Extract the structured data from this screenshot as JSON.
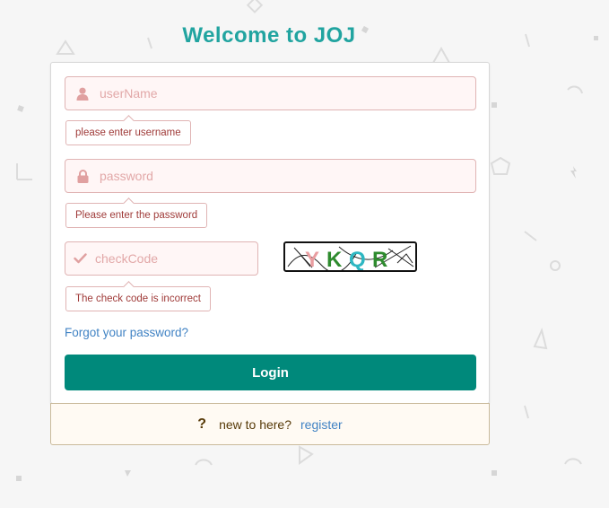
{
  "header": {
    "title": "Welcome to JOJ"
  },
  "form": {
    "username": {
      "placeholder": "userName",
      "value": "",
      "error": "please enter username",
      "icon": "user-icon"
    },
    "password": {
      "placeholder": "password",
      "value": "",
      "error": "Please enter the password",
      "icon": "lock-icon"
    },
    "checkcode": {
      "placeholder": "checkCode",
      "value": "",
      "error": "The check code is incorrect",
      "icon": "checkmark-icon"
    },
    "captcha_text": "YKQR",
    "forgot_label": "Forgot your password?",
    "login_label": "Login"
  },
  "register": {
    "icon": "question-icon",
    "question_glyph": "?",
    "prompt": "new to here?",
    "link_label": "register"
  },
  "colors": {
    "accent": "#21a4a0",
    "button": "#00897b",
    "error_text": "#9f3a38",
    "error_border": "#e0b4b4",
    "link": "#4183c4"
  }
}
